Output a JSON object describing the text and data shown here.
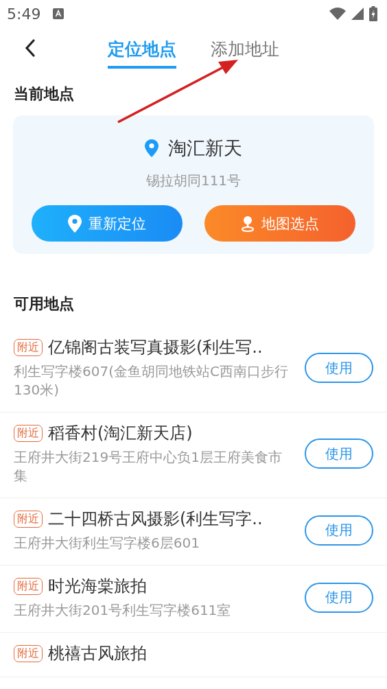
{
  "status_bar": {
    "time": "5:49"
  },
  "tabs": [
    {
      "label": "定位地点",
      "selected": true
    },
    {
      "label": "添加地址",
      "selected": false
    }
  ],
  "current": {
    "heading": "当前地点",
    "name": "淘汇新天",
    "address": "锡拉胡同111号",
    "buttons": [
      {
        "label": "重新定位",
        "kind": "relocate"
      },
      {
        "label": "地图选点",
        "kind": "map"
      }
    ]
  },
  "available": {
    "heading": "可用地点",
    "items": [
      {
        "tag": "附近",
        "name": "亿锦阁古装写真摄影(利生写..",
        "address": "利生写字楼607(金鱼胡同地铁站C西南口步行130米)",
        "action": "使用"
      },
      {
        "tag": "附近",
        "name": "稻香村(淘汇新天店)",
        "address": "王府井大街219号王府中心负1层王府美食市集",
        "action": "使用"
      },
      {
        "tag": "附近",
        "name": "二十四桥古风摄影(利生写字..",
        "address": "王府井大街利生写字楼6层601",
        "action": "使用"
      },
      {
        "tag": "附近",
        "name": "时光海棠旅拍",
        "address": "王府井大街201号利生写字楼611室",
        "action": "使用"
      },
      {
        "tag": "附近",
        "name": "桃禧古风旅拍"
      }
    ]
  },
  "annotation": {
    "kind": "arrow"
  }
}
